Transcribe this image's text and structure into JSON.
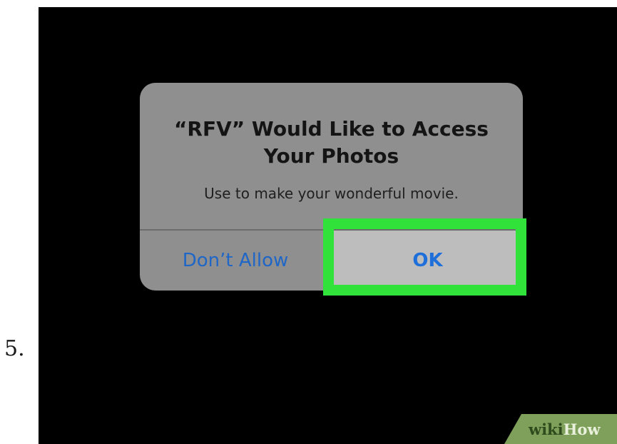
{
  "step_number": "5.",
  "dialog": {
    "title_line_1": "“RFV” Would Like to Access",
    "title_line_2": "Your Photos",
    "message": "Use to make your wonderful movie.",
    "dont_allow_label": "Don’t Allow",
    "ok_label": "OK"
  },
  "highlight": {
    "target": "ok-button",
    "color": "#31e23a"
  },
  "watermark": {
    "text": "wikiHow",
    "color": "#7ea05a"
  }
}
